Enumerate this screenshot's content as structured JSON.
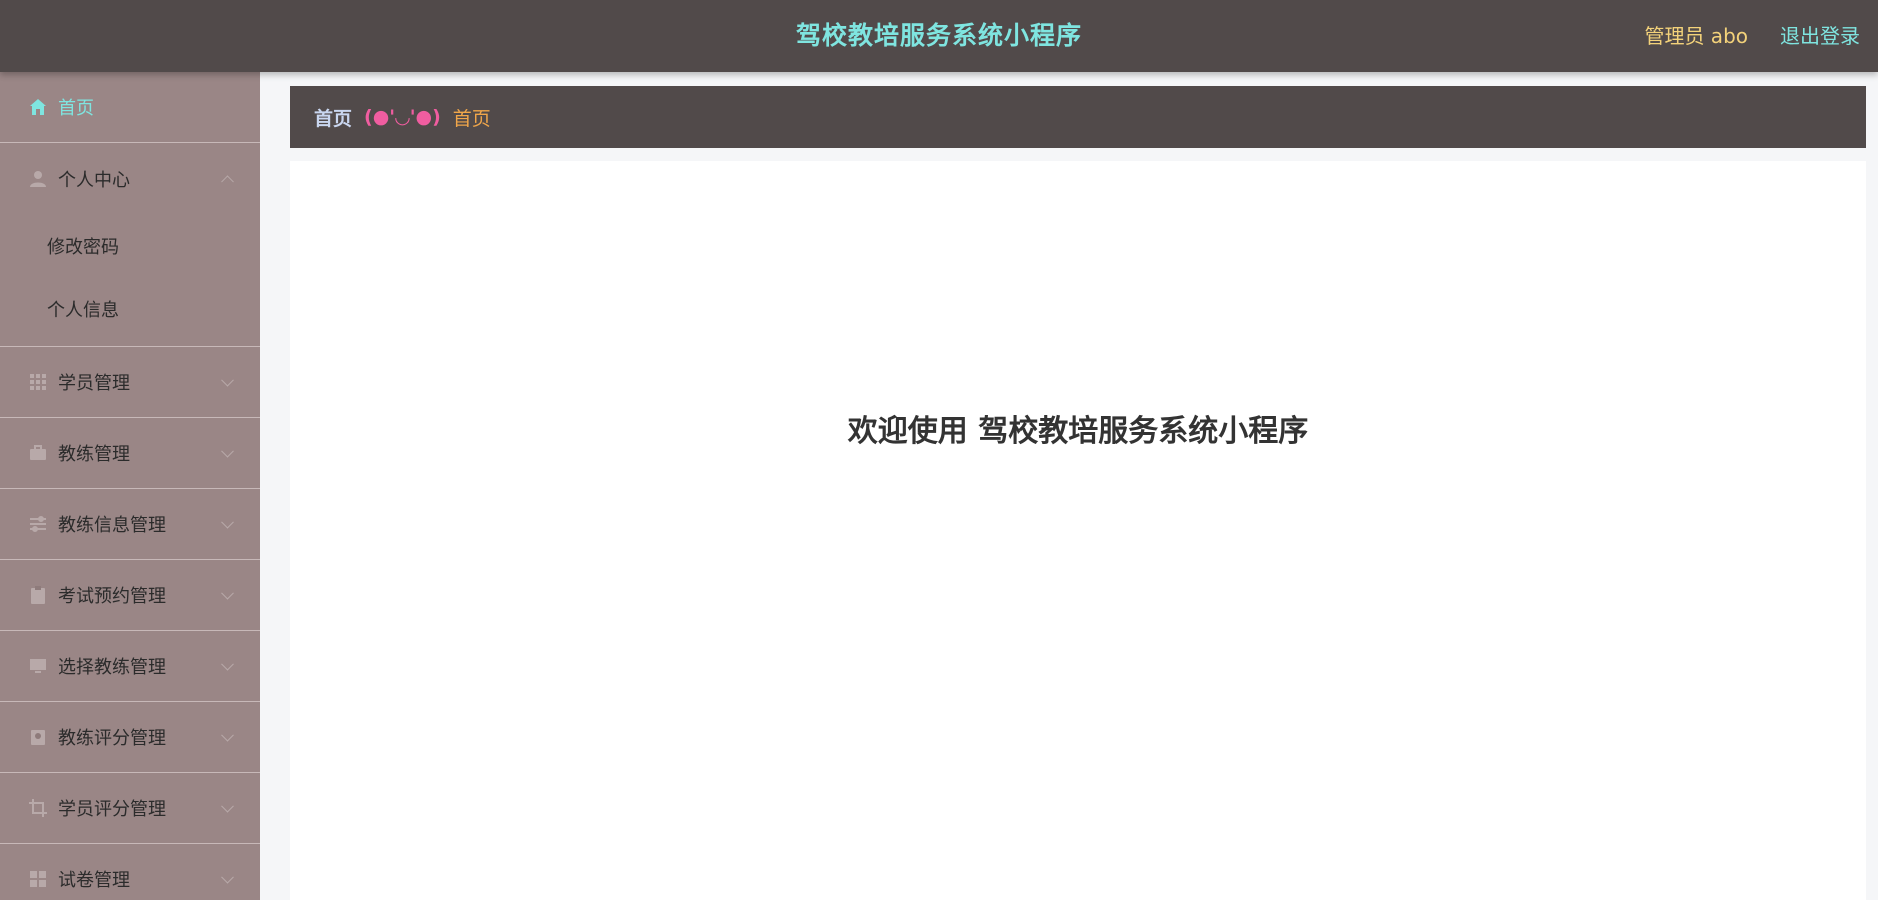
{
  "app": {
    "title": "驾校教培服务系统小程序"
  },
  "header": {
    "user_label": "管理员 abo",
    "logout_label": "退出登录"
  },
  "sidebar": {
    "items": [
      {
        "label": "首页",
        "icon": "home-icon"
      },
      {
        "label": "个人中心",
        "icon": "user-icon",
        "children": [
          "修改密码",
          "个人信息"
        ]
      },
      {
        "label": "学员管理",
        "icon": "grid-icon"
      },
      {
        "label": "教练管理",
        "icon": "briefcase-icon"
      },
      {
        "label": "教练信息管理",
        "icon": "sliders-icon"
      },
      {
        "label": "考试预约管理",
        "icon": "clipboard-icon"
      },
      {
        "label": "选择教练管理",
        "icon": "monitor-icon"
      },
      {
        "label": "教练评分管理",
        "icon": "badge-icon"
      },
      {
        "label": "学员评分管理",
        "icon": "crop-icon"
      },
      {
        "label": "试卷管理",
        "icon": "apps-icon"
      }
    ]
  },
  "breadcrumb": {
    "home": "首页",
    "separator": "(●'◡'●)",
    "current": "首页"
  },
  "main": {
    "welcome_text": "欢迎使用 驾校教培服务系统小程序"
  },
  "colors": {
    "header_bg": "#514a4a",
    "sidebar_bg": "#9a8686",
    "accent_cyan": "#7fe5e0",
    "user_yellow": "#f3d27a",
    "breadcrumb_pink": "#f05da0",
    "breadcrumb_orange": "#f0a64a"
  }
}
